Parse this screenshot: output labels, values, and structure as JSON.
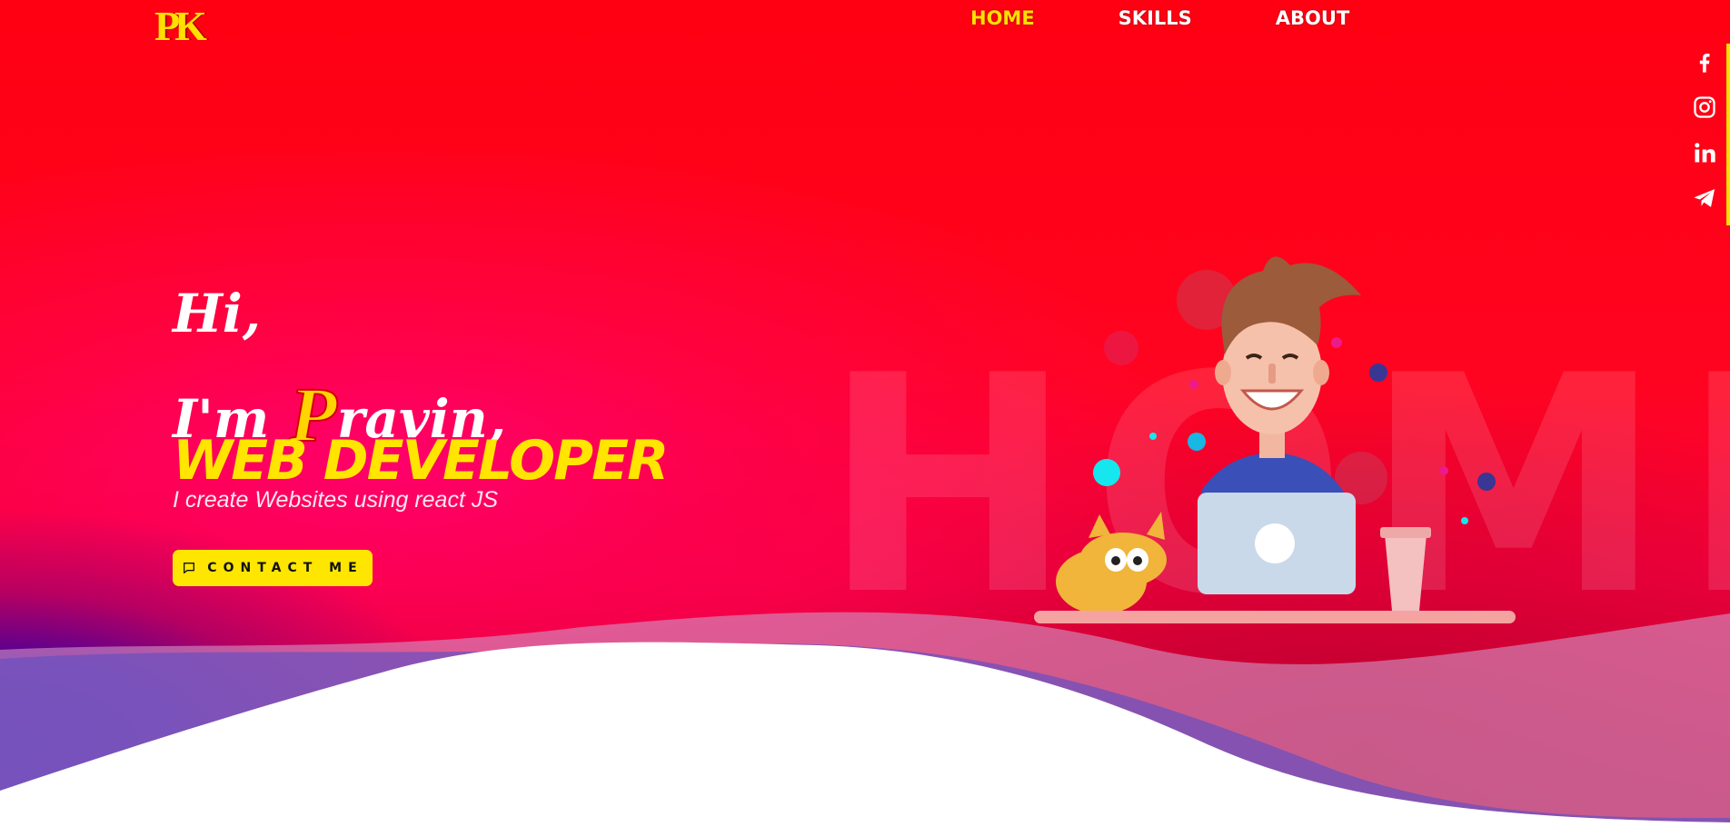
{
  "logo": {
    "text": "PK"
  },
  "nav": {
    "items": [
      {
        "label": "HOME",
        "active": true
      },
      {
        "label": "SKILLS",
        "active": false
      },
      {
        "label": "ABOUT",
        "active": false
      }
    ]
  },
  "social": {
    "icons": [
      "facebook-icon",
      "instagram-icon",
      "linkedin-icon",
      "telegram-icon"
    ]
  },
  "hero": {
    "greeting": "Hi,",
    "im": "I'm",
    "name_initial": "P",
    "name_rest": "ravin,",
    "role": "WEB DEVELOPER",
    "subtitle": "I create Websites using react JS",
    "contact_label": "CONTACT ME",
    "watermark": "HOME"
  },
  "colors": {
    "accent": "#ffe600",
    "background": "#ff0015",
    "wave_white": "#ffffff"
  }
}
